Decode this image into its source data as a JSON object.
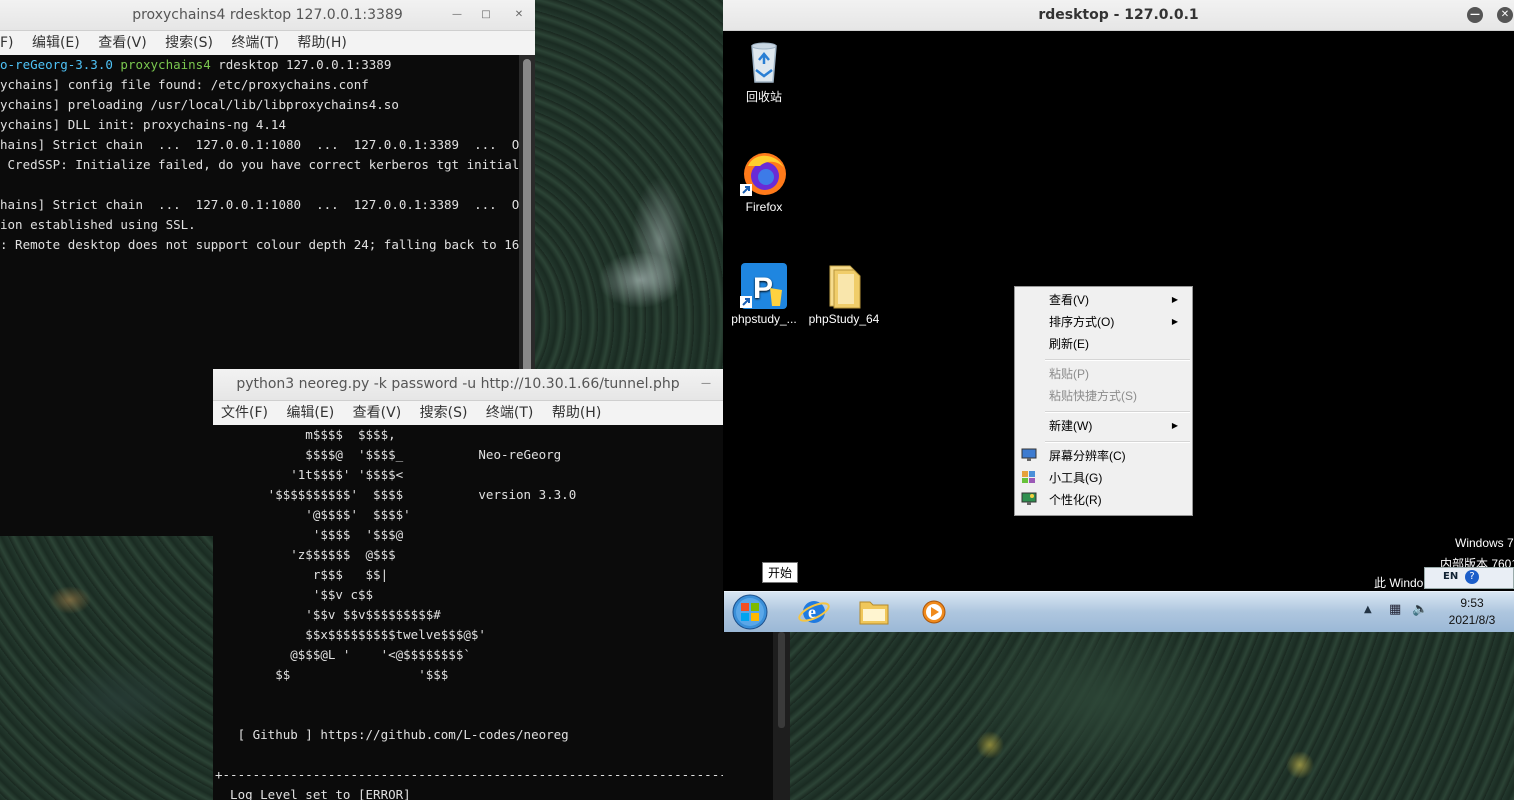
{
  "term1": {
    "title": "proxychains4 rdesktop 127.0.0.1:3389",
    "menu": [
      "F)",
      "编辑(E)",
      "查看(V)",
      "搜索(S)",
      "终端(T)",
      "帮助(H)"
    ],
    "prompt_dir": "o-reGeorg-3.3.0",
    "prompt_cmd": "proxychains4",
    "prompt_args": " rdesktop 127.0.0.1:3389",
    "lines": [
      "ychains] config file found: /etc/proxychains.conf",
      "ychains] preloading /usr/local/lib/libproxychains4.so",
      "ychains] DLL init: proxychains-ng 4.14",
      "hains] Strict chain  ...  127.0.0.1:1080  ...  127.0.0.1:3389  ...  OK",
      " CredSSP: Initialize failed, do you have correct kerberos tgt initialized",
      "",
      "hains] Strict chain  ...  127.0.0.1:1080  ...  127.0.0.1:3389  ...  OK",
      "ion established using SSL.",
      ": Remote desktop does not support colour depth 24; falling back to 16"
    ]
  },
  "term2": {
    "title": "python3 neoreg.py -k password -u http://10.30.1.66/tunnel.php",
    "menu": [
      "文件(F)",
      "编辑(E)",
      "查看(V)",
      "搜索(S)",
      "终端(T)",
      "帮助(H)"
    ],
    "lines": [
      "            m$$$$  $$$$,",
      "            $$$$@  '$$$$_          Neo-reGeorg",
      "          '1t$$$$' '$$$$<",
      "       '$$$$$$$$$$'  $$$$          version 3.3.0",
      "            '@$$$$'  $$$$'",
      "             '$$$$  '$$$@",
      "          'z$$$$$$  @$$$",
      "             r$$$   $$|",
      "             '$$v c$$",
      "            '$$v $$v$$$$$$$$$#",
      "            $$x$$$$$$$$$twelve$$$@$'",
      "          @$$$@L '    '<@$$$$$$$$`",
      "        $$                 '$$$",
      "",
      "",
      "   [ Github ] https://github.com/L-codes/neoreg",
      "",
      "+------------------------------------------------------------------------+",
      "  Log Level set to [ERROR]"
    ]
  },
  "rdesktop": {
    "title": "rdesktop - 127.0.0.1",
    "icons": [
      {
        "label": "回收站",
        "icon": "recycle-bin-icon"
      },
      {
        "label": "Firefox",
        "icon": "firefox-icon"
      },
      {
        "label": "phpstudy_...",
        "icon": "phpstudy-icon"
      },
      {
        "label": "phpStudy_64",
        "icon": "folder-icon"
      }
    ],
    "context_menu": {
      "view": "查看(V)",
      "sort": "排序方式(O)",
      "refresh": "刷新(E)",
      "paste": "粘贴(P)",
      "paste_shortcut": "粘贴快捷方式(S)",
      "new": "新建(W)",
      "resolution": "屏幕分辨率(C)",
      "gadgets": "小工具(G)",
      "personalize": "个性化(R)"
    },
    "watermark_line1": "Windows 7",
    "watermark_line2": "内部版本 7601",
    "watermark_line3": "此 Windo",
    "tooltip": "开始",
    "tray": {
      "lang": "EN",
      "time": "9:53",
      "date": "2021/8/3"
    }
  },
  "colors": {
    "prompt_dir": "#4fc3f7",
    "prompt_cmd": "#7ac74f",
    "win7_taskbar": "#aec6df"
  }
}
